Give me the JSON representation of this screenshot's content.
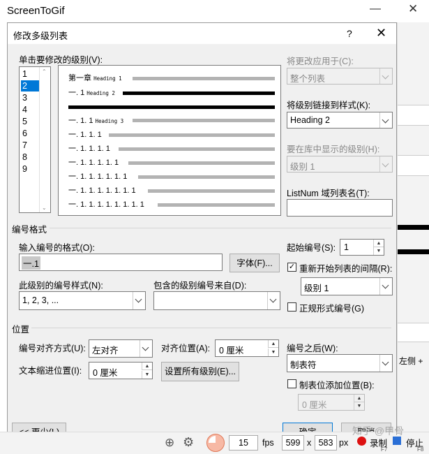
{
  "app": {
    "title": "ScreenToGif"
  },
  "background": {
    "right_label": "左侧 +"
  },
  "dialog": {
    "title": "修改多级列表",
    "help": "?",
    "close": "✕",
    "levels_label": "单击要修改的级别(V):",
    "levels": [
      "1",
      "2",
      "3",
      "4",
      "5",
      "6",
      "7",
      "8",
      "9"
    ],
    "selected_level": "2",
    "preview": {
      "row1_text": "第一章",
      "row1_heading": "Heading 1",
      "row2_text": "一. 1",
      "row2_heading": "Heading 2",
      "row3_text": "一. 1. 1",
      "row3_heading": "Heading 3",
      "rows": [
        "一. 1. 1. 1",
        "一. 1. 1. 1. 1",
        "一. 1. 1. 1. 1. 1",
        "一. 1. 1. 1. 1. 1. 1",
        "一. 1. 1. 1. 1. 1. 1. 1",
        "一. 1. 1. 1. 1. 1. 1. 1. 1"
      ]
    },
    "apply_to_label": "将更改应用于(C):",
    "apply_to_value": "整个列表",
    "link_style_label": "将级别链接到样式(K):",
    "link_style_value": "Heading 2",
    "gallery_level_label": "要在库中显示的级别(H):",
    "gallery_level_value": "级别 1",
    "listnum_label": "ListNum 域列表名(T):",
    "listnum_value": "",
    "number_format_group": "编号格式",
    "enter_format_label": "输入编号的格式(O):",
    "enter_format_value": "一.1",
    "font_button": "字体(F)...",
    "start_at_label": "起始编号(S):",
    "start_at_value": "1",
    "restart_label": "重新开始列表的间隔(R):",
    "restart_checked": true,
    "restart_value": "级别 1",
    "number_style_label": "此级别的编号样式(N):",
    "number_style_value": "1, 2, 3, ...",
    "include_level_label": "包含的级别编号来自(D):",
    "include_level_value": "",
    "legal_label": "正规形式编号(G)",
    "legal_checked": false,
    "position_group": "位置",
    "alignment_label": "编号对齐方式(U):",
    "alignment_value": "左对齐",
    "aligned_at_label": "对齐位置(A):",
    "aligned_at_value": "0 厘米",
    "follow_label": "编号之后(W):",
    "follow_value": "制表符",
    "indent_label": "文本缩进位置(I):",
    "indent_value": "0 厘米",
    "set_all_button": "设置所有级别(E)...",
    "tab_add_label": "制表位添加位置(B):",
    "tab_add_checked": false,
    "tab_add_value": "0 厘米",
    "less_button": "<< 更少(L)",
    "ok_button": "确定",
    "cancel_button": "取消"
  },
  "statusbar": {
    "fps_value": "15",
    "fps_label": "fps",
    "width": "599",
    "x": "x",
    "height": "583",
    "unit": "px",
    "record": "录制",
    "record_key": "F7",
    "stop": "停止",
    "stop_key": "F8",
    "watermark": "知乎 @甲骨"
  }
}
